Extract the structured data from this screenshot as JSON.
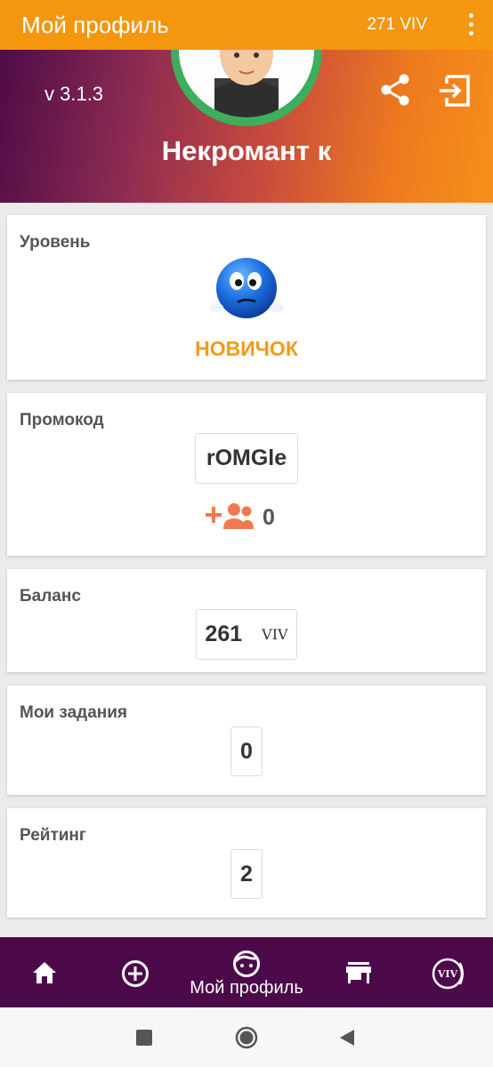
{
  "appbar": {
    "title": "Мой профиль",
    "balance": "271 VIV",
    "menu_icon": "more-vert-icon"
  },
  "profile": {
    "version": "v 3.1.3",
    "username": "Некромант к",
    "share_icon": "share-icon",
    "logout_icon": "logout-icon"
  },
  "level": {
    "label": "Уровень",
    "name": "НОВИЧОК",
    "icon": "confused-smiley-icon"
  },
  "promo": {
    "label": "Промокод",
    "code": "rOMGle",
    "referrals": "0",
    "icon": "add-group-icon"
  },
  "balance": {
    "label": "Баланс",
    "value": "261",
    "unit": "VIV"
  },
  "tasks": {
    "label": "Мои задания",
    "value": "0"
  },
  "rating": {
    "label": "Рейтинг",
    "value": "2"
  },
  "bottom_nav": {
    "items": [
      {
        "icon": "home-icon"
      },
      {
        "icon": "add-circle-icon"
      },
      {
        "icon": "profile-face-icon",
        "label": "Мой профиль"
      },
      {
        "icon": "store-icon"
      },
      {
        "icon": "viv-coin-icon",
        "text": "VIV"
      }
    ]
  },
  "colors": {
    "accent_orange": "#f5960f",
    "nav_purple": "#4d0a4a",
    "level_text": "#f39a17",
    "avatar_ring": "#3fae5c",
    "referral_icon": "#f07a4f"
  }
}
